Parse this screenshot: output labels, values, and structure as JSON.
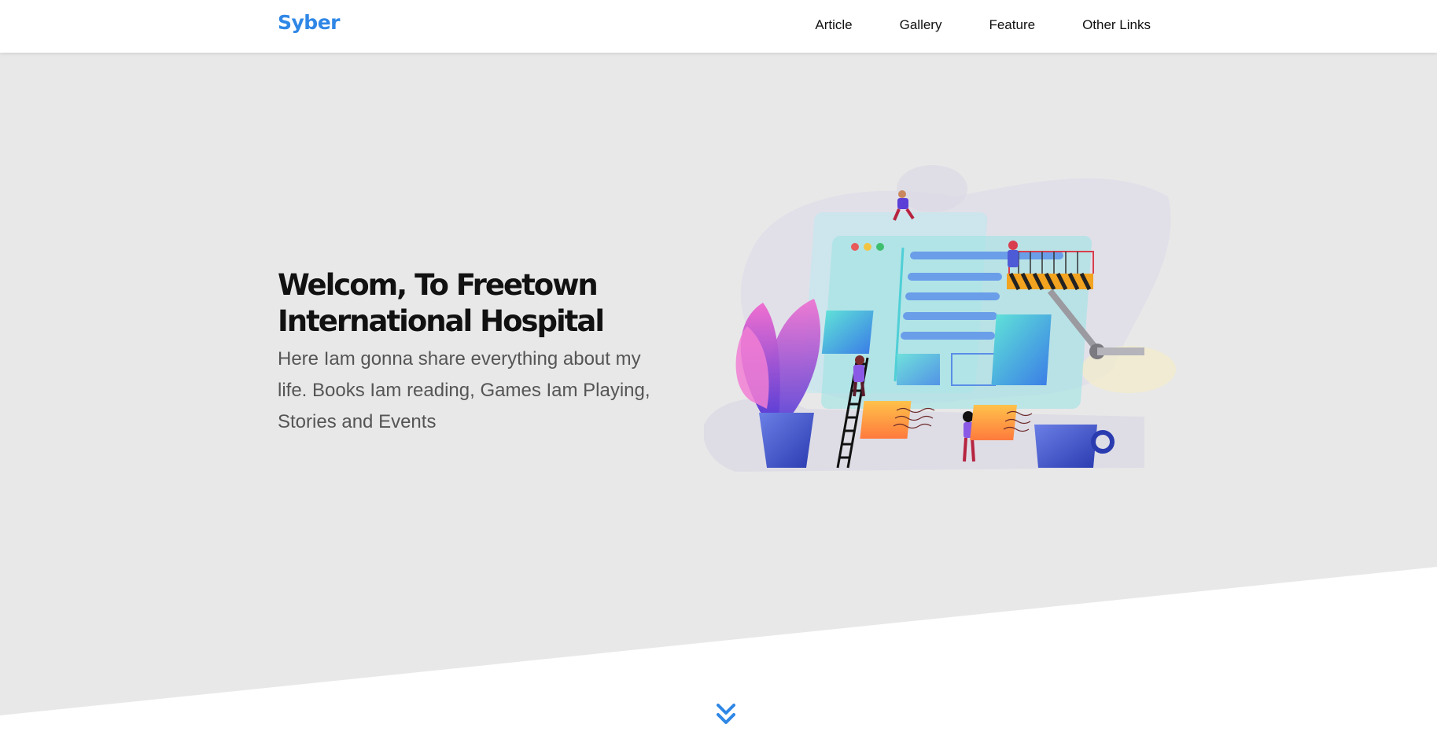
{
  "header": {
    "brand": "Syber",
    "nav": [
      {
        "label": "Article"
      },
      {
        "label": "Gallery"
      },
      {
        "label": "Feature"
      },
      {
        "label": "Other Links"
      }
    ]
  },
  "hero": {
    "title": "Welcom, To Freetown International Hospital",
    "text": "Here Iam gonna share everything about my life. Books Iam reading, Games Iam Playing, Stories and Events"
  },
  "icons": {
    "scroll": "double-chevron-down-icon"
  },
  "colors": {
    "brand": "#2f87e6",
    "hero_bg": "#e8e8e8",
    "accent_purple": "#5b3fd6"
  }
}
